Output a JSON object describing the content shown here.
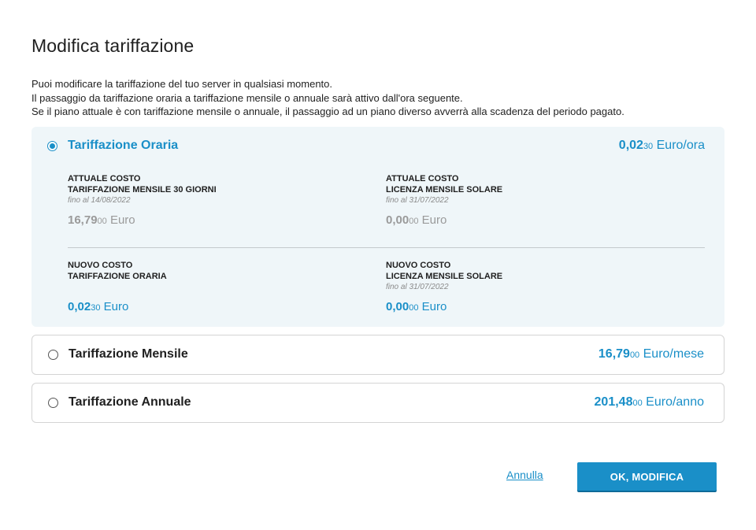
{
  "dialog": {
    "title": "Modifica tariffazione",
    "intro": [
      "Puoi modificare la tariffazione del tuo server in qualsiasi momento.",
      "Il passaggio da tariffazione oraria a tariffazione mensile o annuale sarà attivo dall'ora seguente.",
      "Se il piano attuale è con tariffazione mensile o annuale, il passaggio ad un piano diverso avverrà alla scadenza del periodo pagato."
    ]
  },
  "options": {
    "hourly": {
      "name": "Tariffazione Oraria",
      "selected": true,
      "price_int": "0,02",
      "price_dec": "30",
      "price_unit": " Euro/ora",
      "current_left": {
        "title1": "ATTUALE COSTO",
        "title2": "TARIFFAZIONE MENSILE 30 GIORNI",
        "date": "fino al 14/08/2022",
        "value_int": "16,79",
        "value_dec": "00",
        "value_unit": " Euro"
      },
      "current_right": {
        "title1": "ATTUALE COSTO",
        "title2": "LICENZA MENSILE SOLARE",
        "date": "fino al 31/07/2022",
        "value_int": "0,00",
        "value_dec": "00",
        "value_unit": " Euro"
      },
      "new_left": {
        "title1": "NUOVO COSTO",
        "title2": "TARIFFAZIONE ORARIA",
        "value_int": "0,02",
        "value_dec": "30",
        "value_unit": " Euro"
      },
      "new_right": {
        "title1": "NUOVO COSTO",
        "title2": "LICENZA MENSILE SOLARE",
        "date": "fino al 31/07/2022",
        "value_int": "0,00",
        "value_dec": "00",
        "value_unit": " Euro"
      }
    },
    "monthly": {
      "name": "Tariffazione Mensile",
      "selected": false,
      "price_int": "16,79",
      "price_dec": "00",
      "price_unit": " Euro/mese"
    },
    "yearly": {
      "name": "Tariffazione Annuale",
      "selected": false,
      "price_int": "201,48",
      "price_dec": "00",
      "price_unit": " Euro/anno"
    }
  },
  "actions": {
    "cancel_label": "Annulla",
    "ok_label": "OK, MODIFICA"
  },
  "colors": {
    "accent": "#1a8fc8",
    "selected_bg": "#eff6f9"
  }
}
